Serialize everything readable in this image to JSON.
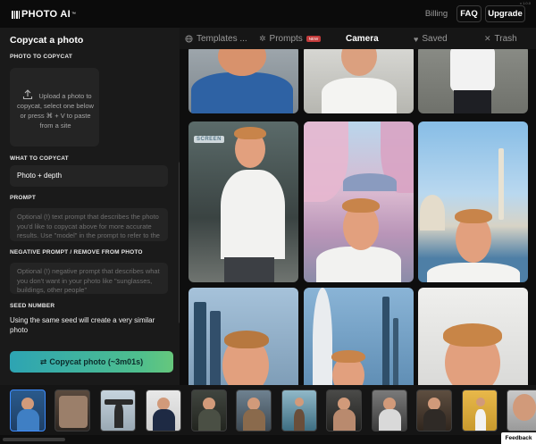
{
  "app": {
    "logo_text": "PHOTO AI",
    "logo_tm": "™",
    "version": "v 1.0.0"
  },
  "topnav": {
    "billing": "Billing",
    "faq": "FAQ",
    "upgrade": "Upgrade"
  },
  "sidebar": {
    "title": "Copycat a photo",
    "photo_label": "PHOTO TO COPYCAT",
    "upload_text": "Upload a photo to copycat, select one below or press ⌘ + V to paste from a site",
    "what_label": "WHAT TO COPYCAT",
    "what_value": "Photo + depth",
    "prompt_label": "PROMPT",
    "prompt_placeholder": "Optional (!) text prompt that describes the photo you'd like to copycat above for more accurate results. Use \"model\" in the prompt to refer to the person",
    "neg_label": "NEGATIVE PROMPT / REMOVE FROM PHOTO",
    "neg_placeholder": "Optional (!) negative prompt that describes what you don't want in your photo like \"sunglasses, buildings, other people\"",
    "seed_label": "SEED NUMBER",
    "seed_text": "Using the same seed will create a very similar photo",
    "cta_icon": "⇄",
    "cta_label": "Copycat photo (~3m01s)"
  },
  "tabs": [
    {
      "label": "Templates ...",
      "icon": "globe-icon"
    },
    {
      "label": "Prompts",
      "icon": "sparkle-icon",
      "badge": "NEW"
    },
    {
      "label": "Camera",
      "icon": ""
    },
    {
      "label": "Saved",
      "icon": "heart-icon"
    },
    {
      "label": "Trash",
      "icon": "close-icon"
    }
  ],
  "gallery": {
    "sign_text": "SCREEN"
  },
  "colors": {
    "accent_start": "#2da4b3",
    "accent_end": "#66c77c",
    "active_thumb": "#3d8cff",
    "new_badge": "#c23b3b"
  },
  "filmstrip": {
    "count": 12,
    "selected_index": 0
  },
  "feedback": "Feedback"
}
